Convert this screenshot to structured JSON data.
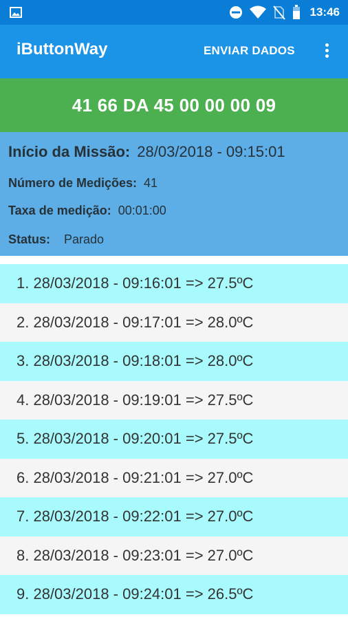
{
  "status_bar": {
    "time": "13:46"
  },
  "app_bar": {
    "title": "iButtonWay",
    "send_label": "ENVIAR DADOS"
  },
  "device_id": "41 66 DA 45 00 00 00 09",
  "mission": {
    "start_label": "Início da Missão:",
    "start_value": "28/03/2018 - 09:15:01",
    "count_label": "Número de Medições:",
    "count_value": "41",
    "rate_label": "Taxa de medição:",
    "rate_value": "00:01:00",
    "status_label": "Status:",
    "status_value": "Parado"
  },
  "measurements": [
    "1. 28/03/2018 - 09:16:01 => 27.5ºC",
    "2. 28/03/2018 - 09:17:01 => 28.0ºC",
    "3. 28/03/2018 - 09:18:01 => 28.0ºC",
    "4. 28/03/2018 - 09:19:01 => 27.5ºC",
    "5. 28/03/2018 - 09:20:01 => 27.5ºC",
    "6. 28/03/2018 - 09:21:01 => 27.0ºC",
    "7. 28/03/2018 - 09:22:01 => 27.0ºC",
    "8. 28/03/2018 - 09:23:01 => 27.0ºC",
    "9. 28/03/2018 - 09:24:01 => 26.5ºC"
  ],
  "colors": {
    "status_bar": "#0a7ed6",
    "app_bar": "#1b93e6",
    "id_bar": "#4caf50",
    "info_panel": "#5dade6",
    "row_highlight": "#a8fafc",
    "row_plain": "#f5f5f5"
  },
  "icons": [
    "image-icon",
    "do-not-disturb-icon",
    "wifi-icon",
    "no-sim-icon",
    "battery-icon",
    "more-vert-icon"
  ]
}
